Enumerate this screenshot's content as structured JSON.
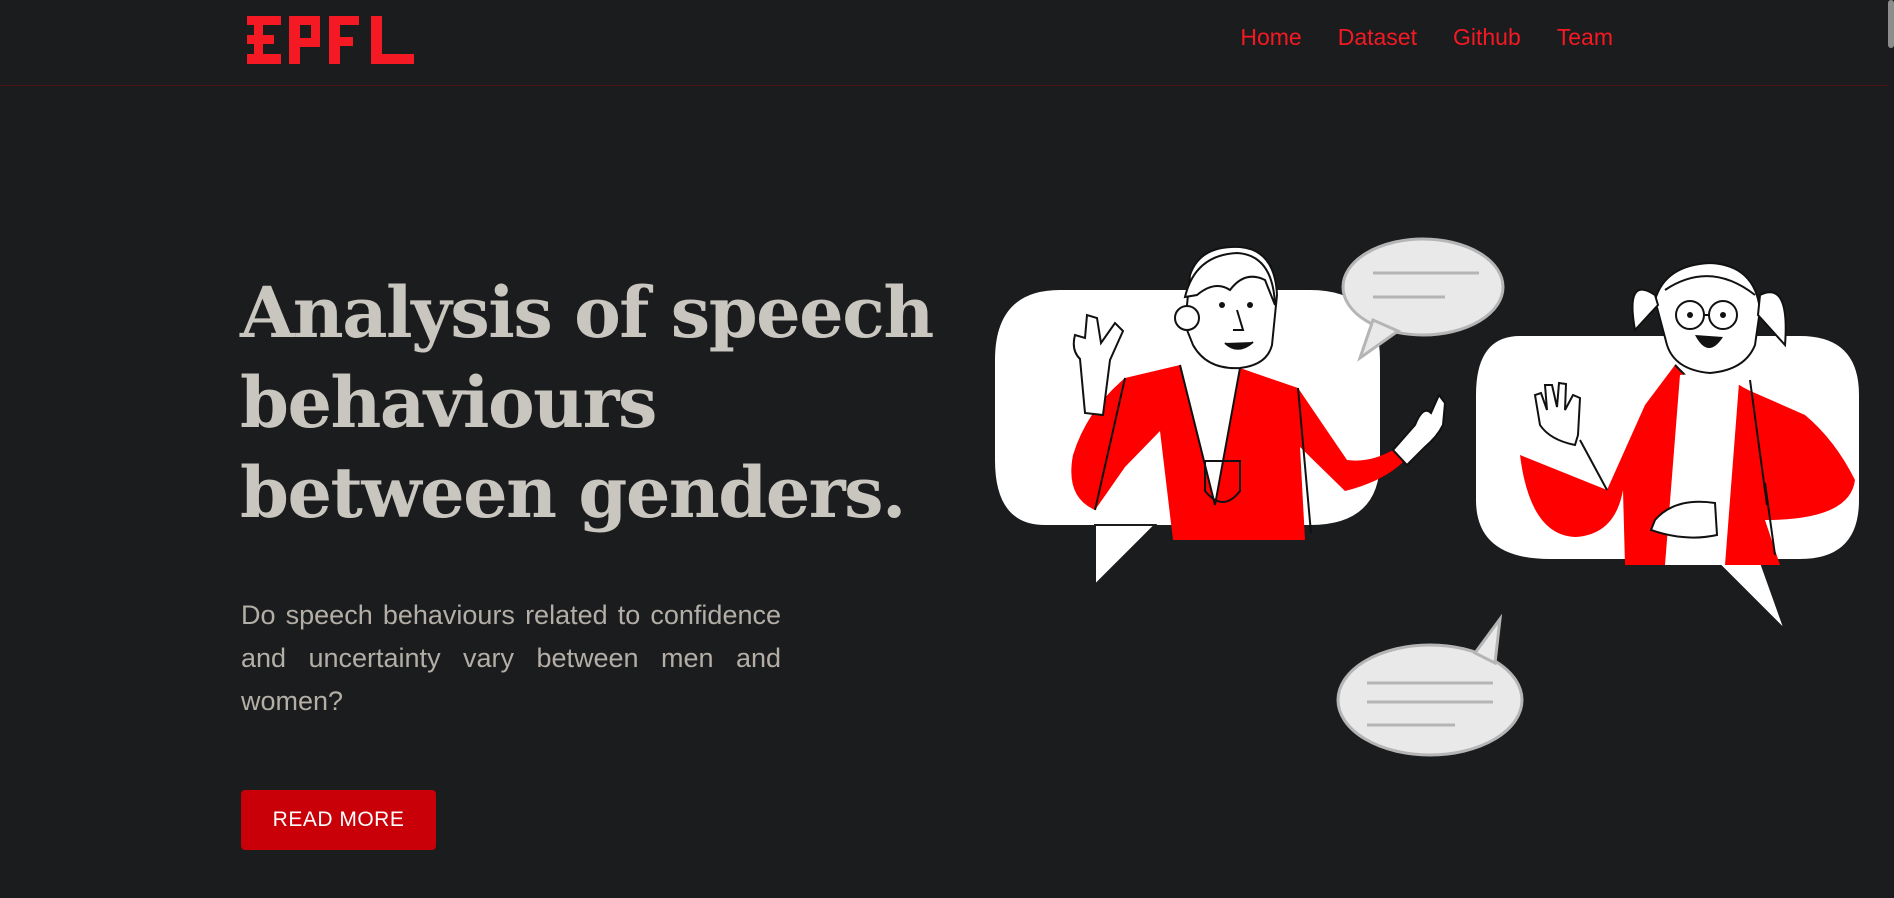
{
  "brand": {
    "logo_text": "EPFL",
    "accent": "#f41923"
  },
  "nav": {
    "items": [
      "Home",
      "Dataset",
      "Github",
      "Team"
    ]
  },
  "hero": {
    "title_lines": [
      "Analysis of speech",
      "behaviours",
      "between genders."
    ],
    "subtitle": "Do speech behaviours related to confidence and uncertainty vary between men and women?",
    "cta_label": "READ MORE"
  },
  "colors": {
    "background": "#1b1c1e",
    "title": "#c9c5bf",
    "body_text": "#b3aea6",
    "button": "#c90008",
    "illustration_red": "#ff0000"
  },
  "illustration": {
    "name": "two-people-conversation-illustration"
  }
}
